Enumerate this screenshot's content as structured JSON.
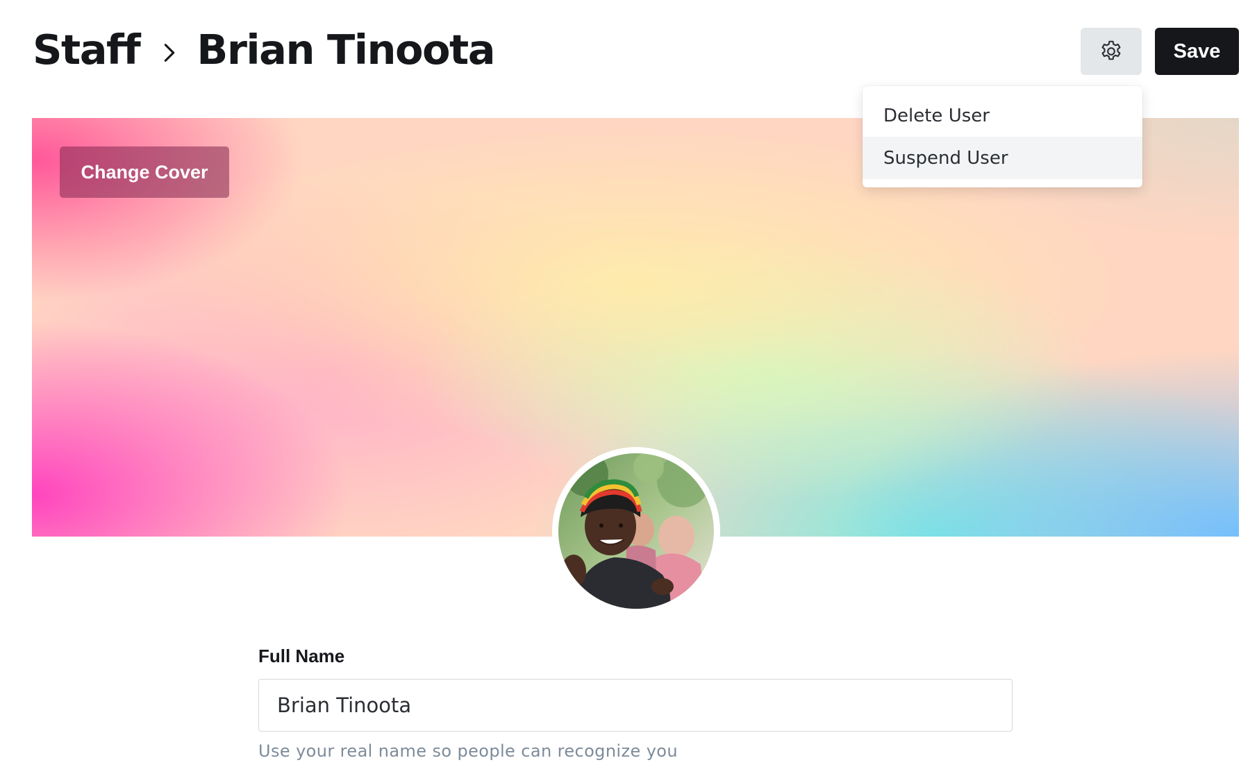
{
  "breadcrumb": {
    "parent": "Staff",
    "current": "Brian Tinoota",
    "separator_icon": "chevron-right-icon"
  },
  "toolbar": {
    "settings_icon": "gear-icon",
    "save_label": "Save"
  },
  "settings_menu": {
    "items": [
      {
        "label": "Delete User"
      },
      {
        "label": "Suspend User"
      }
    ]
  },
  "cover": {
    "change_label": "Change Cover"
  },
  "profile": {
    "avatar_icon": "profile-photo"
  },
  "form": {
    "full_name": {
      "label": "Full Name",
      "value": "Brian Tinoota",
      "hint": "Use your real name so people can recognize you"
    }
  },
  "colors": {
    "primary_button": "#15171a",
    "secondary_button": "#e4e7ea",
    "hint_text": "#7c8b9a"
  }
}
